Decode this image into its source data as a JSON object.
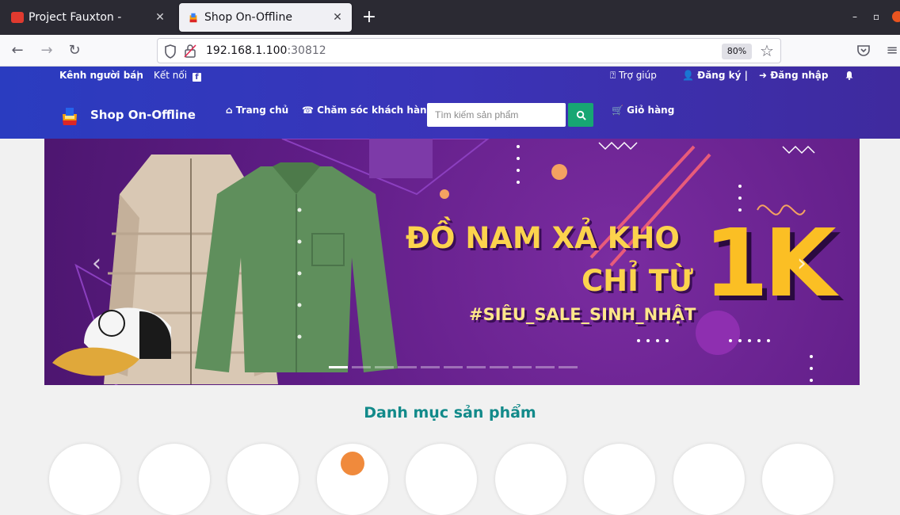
{
  "browser": {
    "tabs": [
      {
        "title": "Project Fauxton -",
        "active": false
      },
      {
        "title": "Shop On-Offline",
        "active": true
      }
    ],
    "url_host": "192.168.1.100",
    "url_port": ":30812",
    "zoom": "80%"
  },
  "header": {
    "seller_channel": "Kênh người bán",
    "separator": "|",
    "connect": "Kết nối",
    "help": "Trợ giúp",
    "register": "Đăng ký",
    "login": "Đăng nhập",
    "brand": "Shop On-Offline",
    "menu_home": "Trang chủ",
    "menu_care": "Chăm sóc khách hàng",
    "search_placeholder": "Tìm kiếm sản phẩm",
    "menu_cart": "Giỏ hàng"
  },
  "banner": {
    "line1": "ĐỒ NAM XẢ KHO",
    "line2": "CHỈ TỪ",
    "big": "1K",
    "hashtag": "#SIÊU_SALE_SINH_NHẬT",
    "slide_count": 11,
    "active_slide": 1
  },
  "categories": {
    "title": "Danh mục sản phẩm",
    "count": 9
  },
  "colors": {
    "header_start": "#2a3cc0",
    "header_end": "#3f2a9e",
    "search_button": "#17a673",
    "category_title": "#128a8a",
    "banner_bg": "#5f1d86",
    "banner_text": "#fcd34d"
  }
}
